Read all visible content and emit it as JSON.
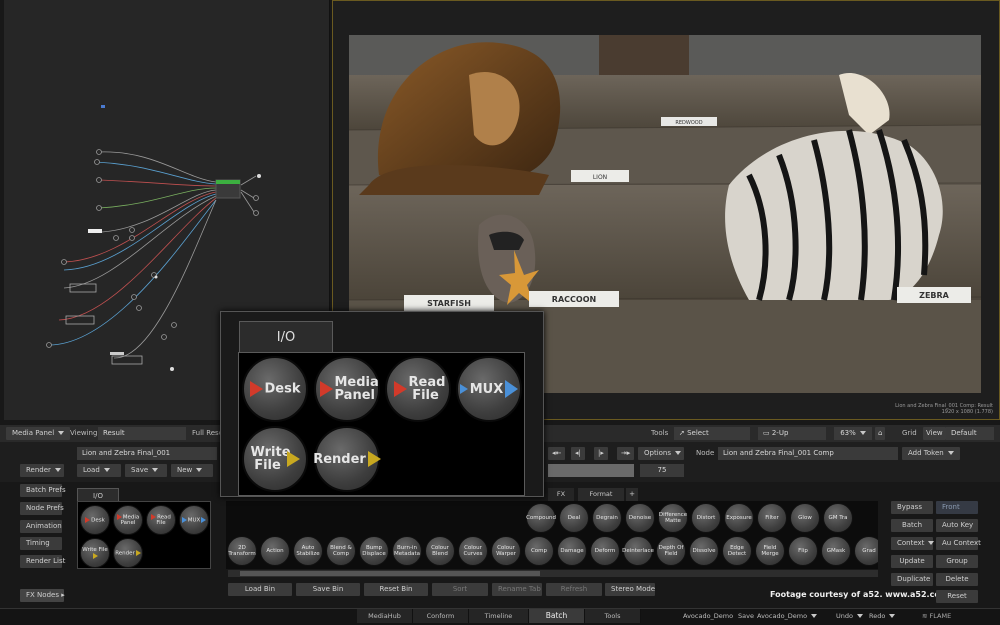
{
  "viewer": {
    "image_caption_line1": "Lion and Zebra Final_001 Comp: Result",
    "image_caption_line2": "1920 x 1080 (1.778)",
    "signs": {
      "redwood": "REDWOOD",
      "lion": "LION",
      "starfish": "STARFISH",
      "raccoon": "RACCOON",
      "zebra": "ZEBRA"
    }
  },
  "viewer_bar": {
    "media_panel": "Media Panel",
    "viewing_label": "Viewing",
    "viewing_value": "Result",
    "full_res": "Full Reso",
    "tools_label": "Tools",
    "select": "Select",
    "two_up": "2-Up",
    "zoom": "63%",
    "grid": "Grid",
    "view": "View",
    "default": "Default"
  },
  "batch_bar": {
    "render": "Render",
    "batch_name": "Lion and Zebra Final_001",
    "load": "Load",
    "save": "Save",
    "new": "New",
    "options": "Options",
    "frame": "75",
    "node_label": "Node",
    "node_value": "Lion and Zebra Final_001 Comp",
    "add_token": "Add Token"
  },
  "left_buttons": [
    "Batch Prefs",
    "Node Prefs",
    "Animation",
    "Timing",
    "Render List"
  ],
  "fx_nodes": "FX Nodes",
  "small_bin": {
    "tab": "I/O",
    "nodes": [
      {
        "label": "Desk",
        "arrow": "red"
      },
      {
        "label": "Media Panel",
        "arrow": "red"
      },
      {
        "label": "Read File",
        "arrow": "red"
      },
      {
        "label": "MUX",
        "arrow": "blue"
      },
      {
        "label": "Write File",
        "arrow": "yellow"
      },
      {
        "label": "Render",
        "arrow": "yellow"
      }
    ]
  },
  "popup": {
    "tab": "I/O",
    "nodes": [
      {
        "label": "Desk",
        "arrow": "red"
      },
      {
        "label": "Media Panel",
        "arrow": "red"
      },
      {
        "label": "Read File",
        "arrow": "red"
      },
      {
        "label": "MUX",
        "arrow": "blue"
      },
      {
        "label": "Write File",
        "arrow": "yellow"
      },
      {
        "label": "Render",
        "arrow": "yellow"
      }
    ]
  },
  "fx_tabs": [
    "FX",
    "Format",
    "+"
  ],
  "fx_row1": [
    "Compound",
    "Deal",
    "Degrain",
    "Denoise",
    "Difference Matte",
    "Distort",
    "Exposure",
    "Filter",
    "Glow",
    "GM Tra"
  ],
  "fx_row2": [
    "2D Transform",
    "Action",
    "Auto Stabilize",
    "Blend & Comp",
    "Bump Displace",
    "Burn-in Metadata",
    "Colour Blend",
    "Colour Curves",
    "Colour Warper",
    "Comp",
    "Damage",
    "Deform",
    "Deinterlace",
    "Depth Of Field",
    "Dissolve",
    "Edge Detect",
    "Field Merge",
    "Flip",
    "GMask",
    "Grad"
  ],
  "bin_buttons": [
    "Load Bin",
    "Save Bin",
    "Reset Bin",
    "Sort",
    "Rename Tab",
    "Refresh",
    "Stereo Mode"
  ],
  "right_buttons": [
    [
      "Bypass",
      "Front"
    ],
    [
      "Batch",
      "Auto Key"
    ],
    [
      "Context",
      "Au Context"
    ],
    [
      "Update",
      "Group"
    ],
    [
      "Duplicate",
      "Delete"
    ],
    [
      "",
      "Reset"
    ]
  ],
  "credit": "Footage courtesy of a52. www.a52.com",
  "bottom_tabs": [
    "MediaHub",
    "Conform",
    "Timeline",
    "Batch",
    "Tools"
  ],
  "status": {
    "project": "Avocado_Demo",
    "save": "Save",
    "save_target": "Avocado_Demo",
    "undo": "Undo",
    "redo": "Redo",
    "brand": "FLAME"
  },
  "colors": {
    "accent": "#6a5a20",
    "red_arrow": "#d23a2a",
    "yellow_arrow": "#c8a820",
    "blue_arrow": "#4a90d8"
  }
}
